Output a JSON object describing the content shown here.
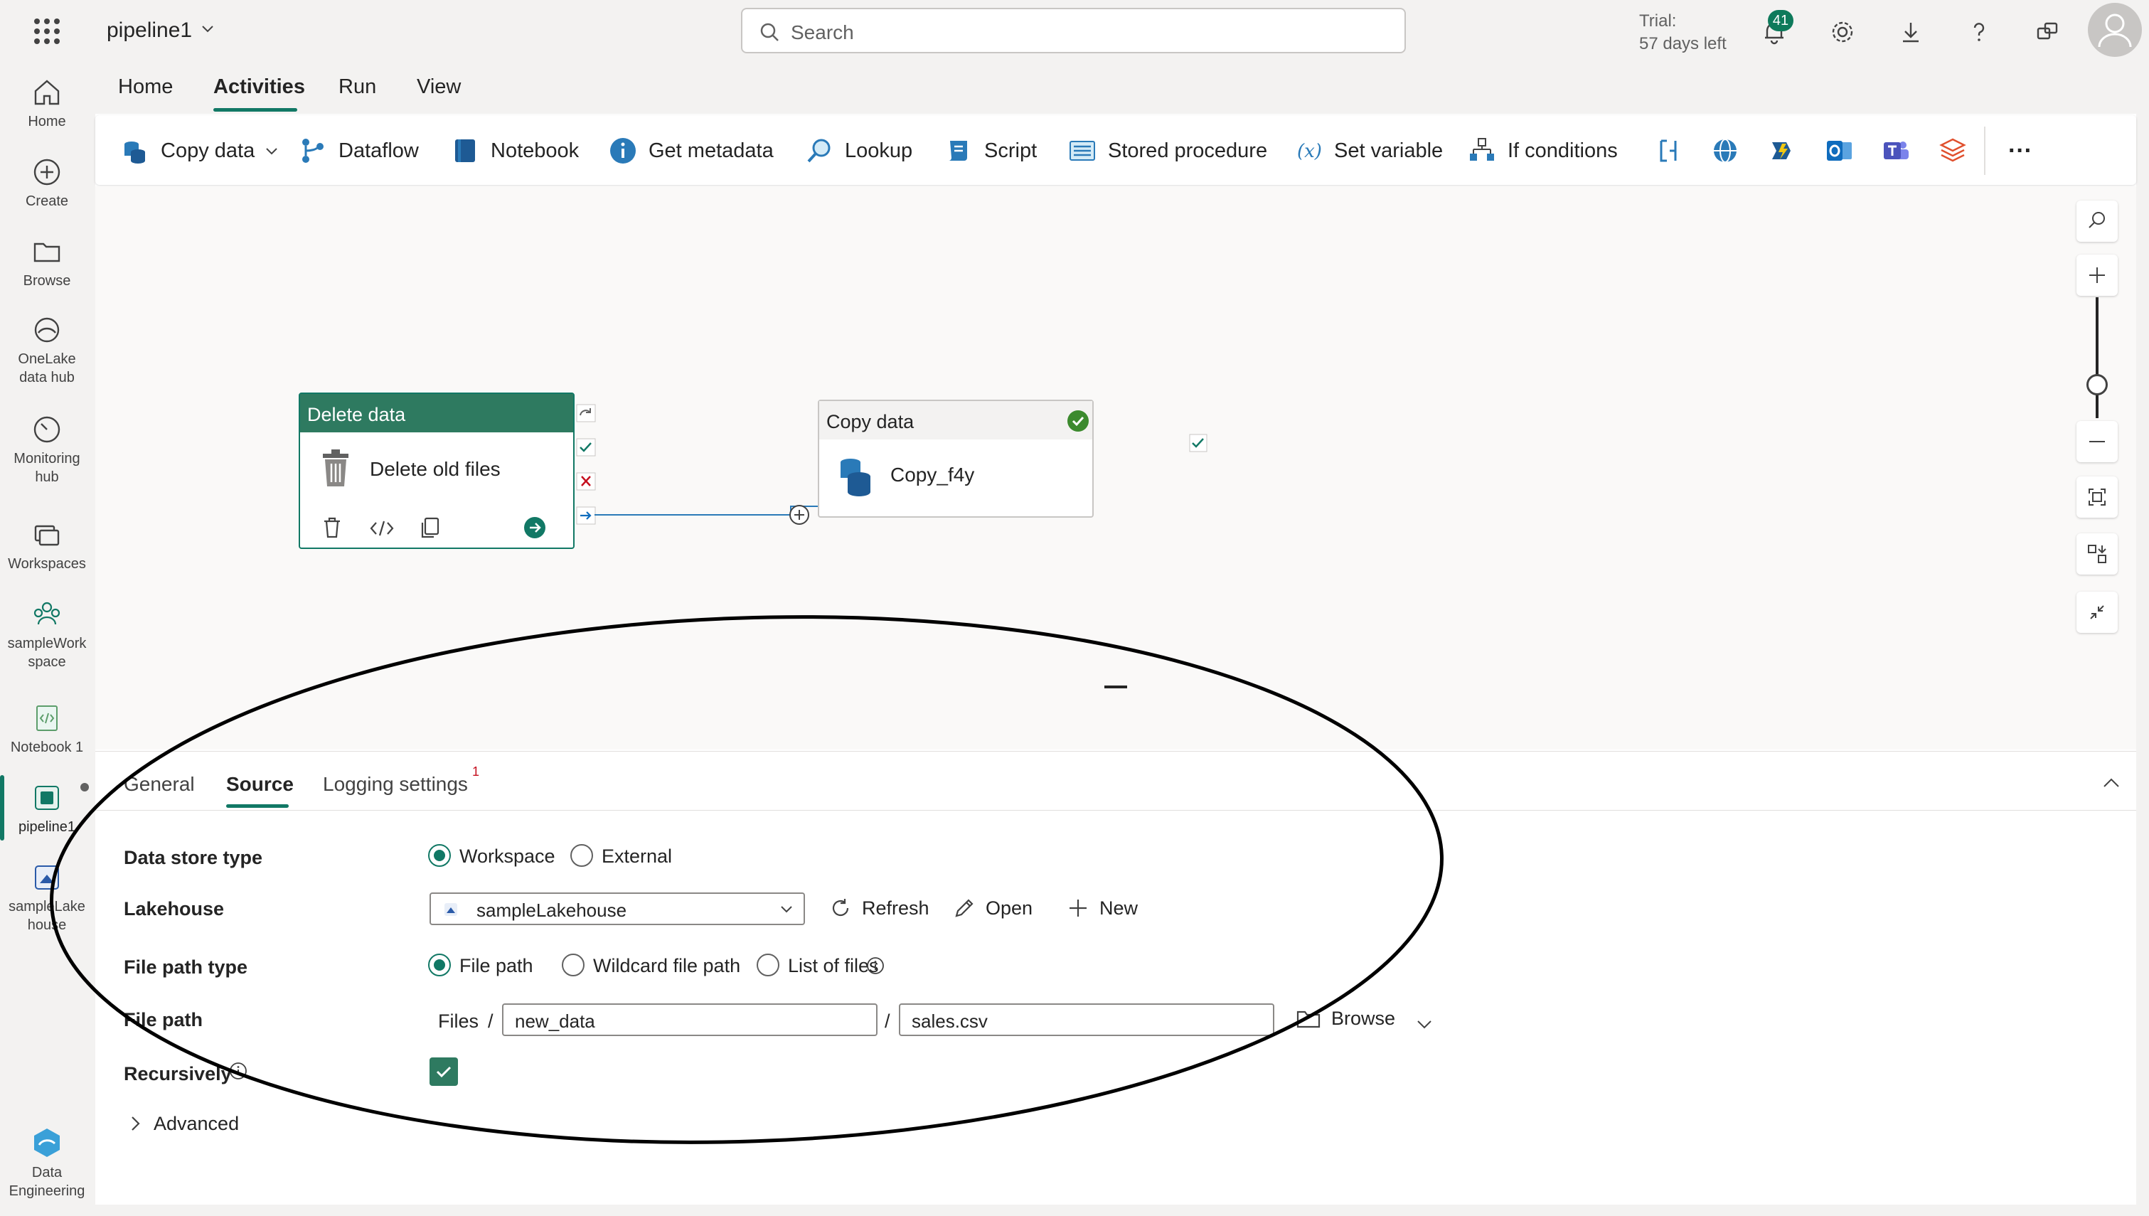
{
  "app": {
    "title": "pipeline1",
    "search_placeholder": "Search",
    "trial_line1": "Trial:",
    "trial_line2": "57 days left",
    "notification_count": "41",
    "accent_color": "#117865"
  },
  "rail": {
    "items": [
      {
        "label": "Home",
        "icon": "home-icon"
      },
      {
        "label": "Create",
        "icon": "create-icon"
      },
      {
        "label": "Browse",
        "icon": "folder-icon"
      },
      {
        "label_line1": "OneLake",
        "label_line2": "data hub",
        "icon": "onelake-icon"
      },
      {
        "label_line1": "Monitoring",
        "label_line2": "hub",
        "icon": "monitoring-icon"
      },
      {
        "label": "Workspaces",
        "icon": "workspaces-icon"
      },
      {
        "label_line1": "sampleWork",
        "label_line2": "space",
        "icon": "group-icon"
      },
      {
        "label": "Notebook 1",
        "icon": "notebook-icon"
      },
      {
        "label": "pipeline1",
        "icon": "pipeline-icon"
      },
      {
        "label_line1": "sampleLake",
        "label_line2": "house",
        "icon": "lakehouse-icon"
      },
      {
        "label_line1": "Data",
        "label_line2": "Engineering",
        "icon": "data-engineering-icon"
      }
    ]
  },
  "menu_tabs": [
    "Home",
    "Activities",
    "Run",
    "View"
  ],
  "active_menu_tab": "Activities",
  "ribbon": {
    "copy_data": "Copy data",
    "dataflow": "Dataflow",
    "notebook": "Notebook",
    "get_metadata": "Get metadata",
    "lookup": "Lookup",
    "script": "Script",
    "stored_procedure": "Stored procedure",
    "set_variable": "Set variable",
    "if_conditions": "If conditions",
    "more": "···"
  },
  "canvas": {
    "delete_node": {
      "header": "Delete data",
      "name": "Delete old files"
    },
    "copy_node": {
      "header": "Copy data",
      "name": "Copy_f4y"
    }
  },
  "properties": {
    "tabs": [
      "General",
      "Source",
      "Logging settings"
    ],
    "active_tab": "Source",
    "logging_badge": "1",
    "data_store_type": {
      "label": "Data store type",
      "options": [
        "Workspace",
        "External"
      ],
      "selected": "Workspace"
    },
    "lakehouse": {
      "label": "Lakehouse",
      "value": "sampleLakehouse",
      "refresh": "Refresh",
      "open": "Open",
      "new": "New"
    },
    "file_path_type": {
      "label": "File path type",
      "options": [
        "File path",
        "Wildcard file path",
        "List of files"
      ],
      "selected": "File path"
    },
    "file_path": {
      "label": "File path",
      "prefix": "Files",
      "separator": "/",
      "folder": "new_data",
      "file": "sales.csv",
      "browse": "Browse"
    },
    "recursively": {
      "label": "Recursively",
      "checked": true
    },
    "advanced": "Advanced"
  }
}
